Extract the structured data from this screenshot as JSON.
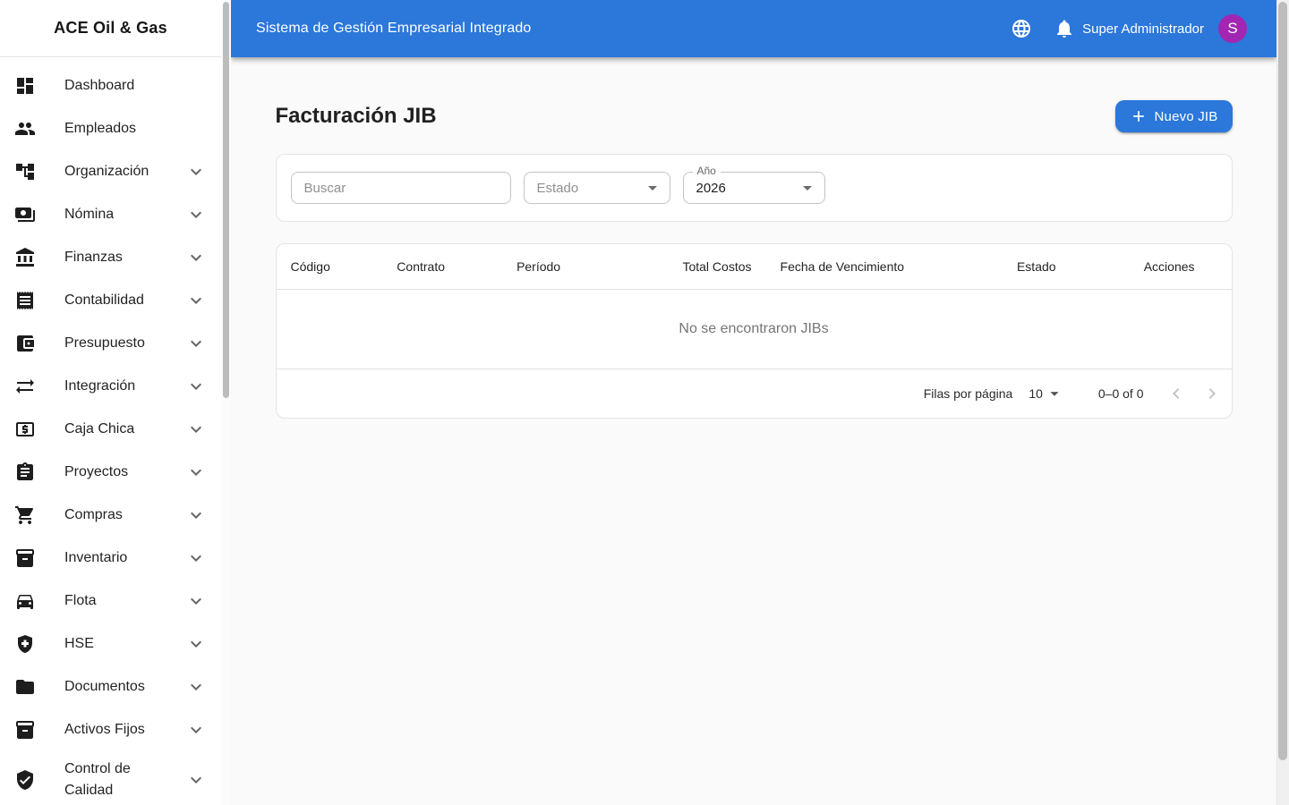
{
  "colors": {
    "primary": "#2b77da",
    "avatar": "#a226b2"
  },
  "sidebar": {
    "brand": "ACE Oil & Gas",
    "items": [
      {
        "label": "Dashboard",
        "icon": "dashboard-icon",
        "expandable": false
      },
      {
        "label": "Empleados",
        "icon": "people-icon",
        "expandable": false
      },
      {
        "label": "Organización",
        "icon": "org-tree-icon",
        "expandable": true
      },
      {
        "label": "Nómina",
        "icon": "payments-card-icon",
        "expandable": true
      },
      {
        "label": "Finanzas",
        "icon": "bank-icon",
        "expandable": true
      },
      {
        "label": "Contabilidad",
        "icon": "receipt-icon",
        "expandable": true
      },
      {
        "label": "Presupuesto",
        "icon": "wallet-icon",
        "expandable": true
      },
      {
        "label": "Integración",
        "icon": "swap-arrows-icon",
        "expandable": true
      },
      {
        "label": "Caja Chica",
        "icon": "cash-icon",
        "expandable": true
      },
      {
        "label": "Proyectos",
        "icon": "clipboard-icon",
        "expandable": true
      },
      {
        "label": "Compras",
        "icon": "shopping-cart-icon",
        "expandable": true
      },
      {
        "label": "Inventario",
        "icon": "inventory-box-icon",
        "expandable": true
      },
      {
        "label": "Flota",
        "icon": "car-icon",
        "expandable": true
      },
      {
        "label": "HSE",
        "icon": "health-shield-icon",
        "expandable": true
      },
      {
        "label": "Documentos",
        "icon": "folder-icon",
        "expandable": true
      },
      {
        "label": "Activos Fijos",
        "icon": "inventory-box-icon",
        "expandable": true
      },
      {
        "label": "Control de Calidad",
        "icon": "verified-shield-icon",
        "expandable": true
      }
    ]
  },
  "appbar": {
    "title": "Sistema de Gestión Empresarial Integrado",
    "language_icon": "globe-icon",
    "notifications_icon": "bell-icon",
    "user_name": "Super Administrador",
    "avatar_initial": "S"
  },
  "page": {
    "title": "Facturación JIB",
    "new_button_label": "Nuevo JIB",
    "new_button_icon": "plus-icon"
  },
  "filters": {
    "search_placeholder": "Buscar",
    "estado_placeholder": "Estado",
    "anio_label": "Año",
    "anio_value": "2026",
    "select_arrow_icon": "arrow-drop-down-icon"
  },
  "table": {
    "columns": [
      "Código",
      "Contrato",
      "Período",
      "Total Costos",
      "Fecha de Vencimiento",
      "Estado",
      "Acciones"
    ],
    "empty_message": "No se encontraron JIBs",
    "pagination": {
      "rows_per_page_label": "Filas por página",
      "rows_per_page_value": "10",
      "range_label": "0–0 of 0",
      "prev_icon": "chevron-left-icon",
      "next_icon": "chevron-right-icon"
    }
  }
}
